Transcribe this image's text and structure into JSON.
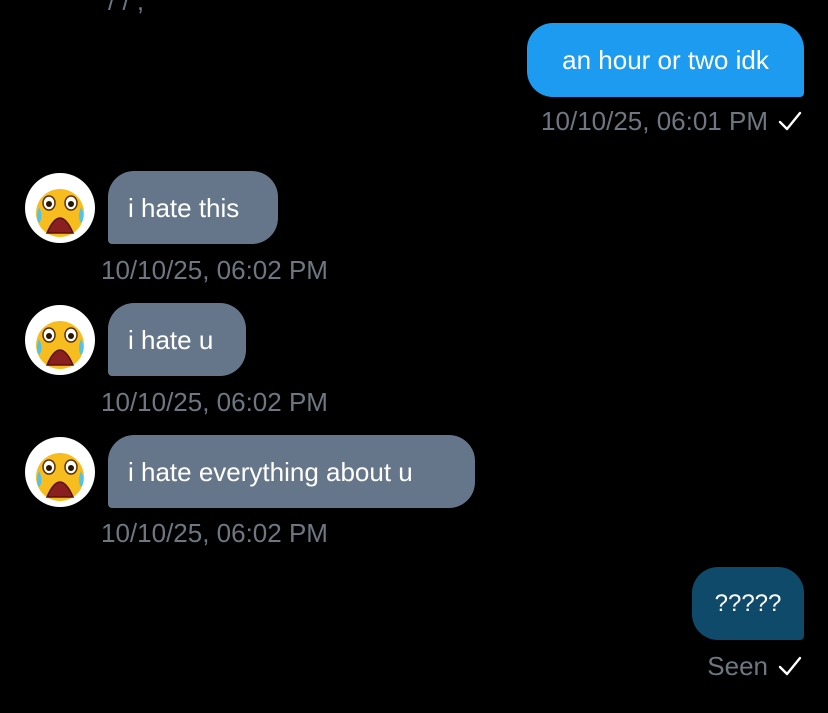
{
  "messages": [
    {
      "text": "an hour or two idk",
      "timestamp": "10/10/25, 06:01 PM",
      "status_icon": "check-icon"
    },
    {
      "text": "i hate this",
      "timestamp": "10/10/25, 06:02 PM",
      "avatar_icon": "crying-emoji-icon"
    },
    {
      "text": "i hate u",
      "timestamp": "10/10/25, 06:02 PM",
      "avatar_icon": "crying-emoji-icon"
    },
    {
      "text": "i hate everything about u",
      "timestamp": "10/10/25, 06:02 PM",
      "avatar_icon": "crying-emoji-icon"
    },
    {
      "text": "?????",
      "status": "Seen",
      "status_icon": "check-icon"
    }
  ],
  "colors": {
    "outgoing_bubble": "#1d9bf0",
    "outgoing_bubble_last": "#0f4a6b",
    "incoming_bubble": "#66768a",
    "meta_text": "#6e7781",
    "background": "#000000"
  }
}
